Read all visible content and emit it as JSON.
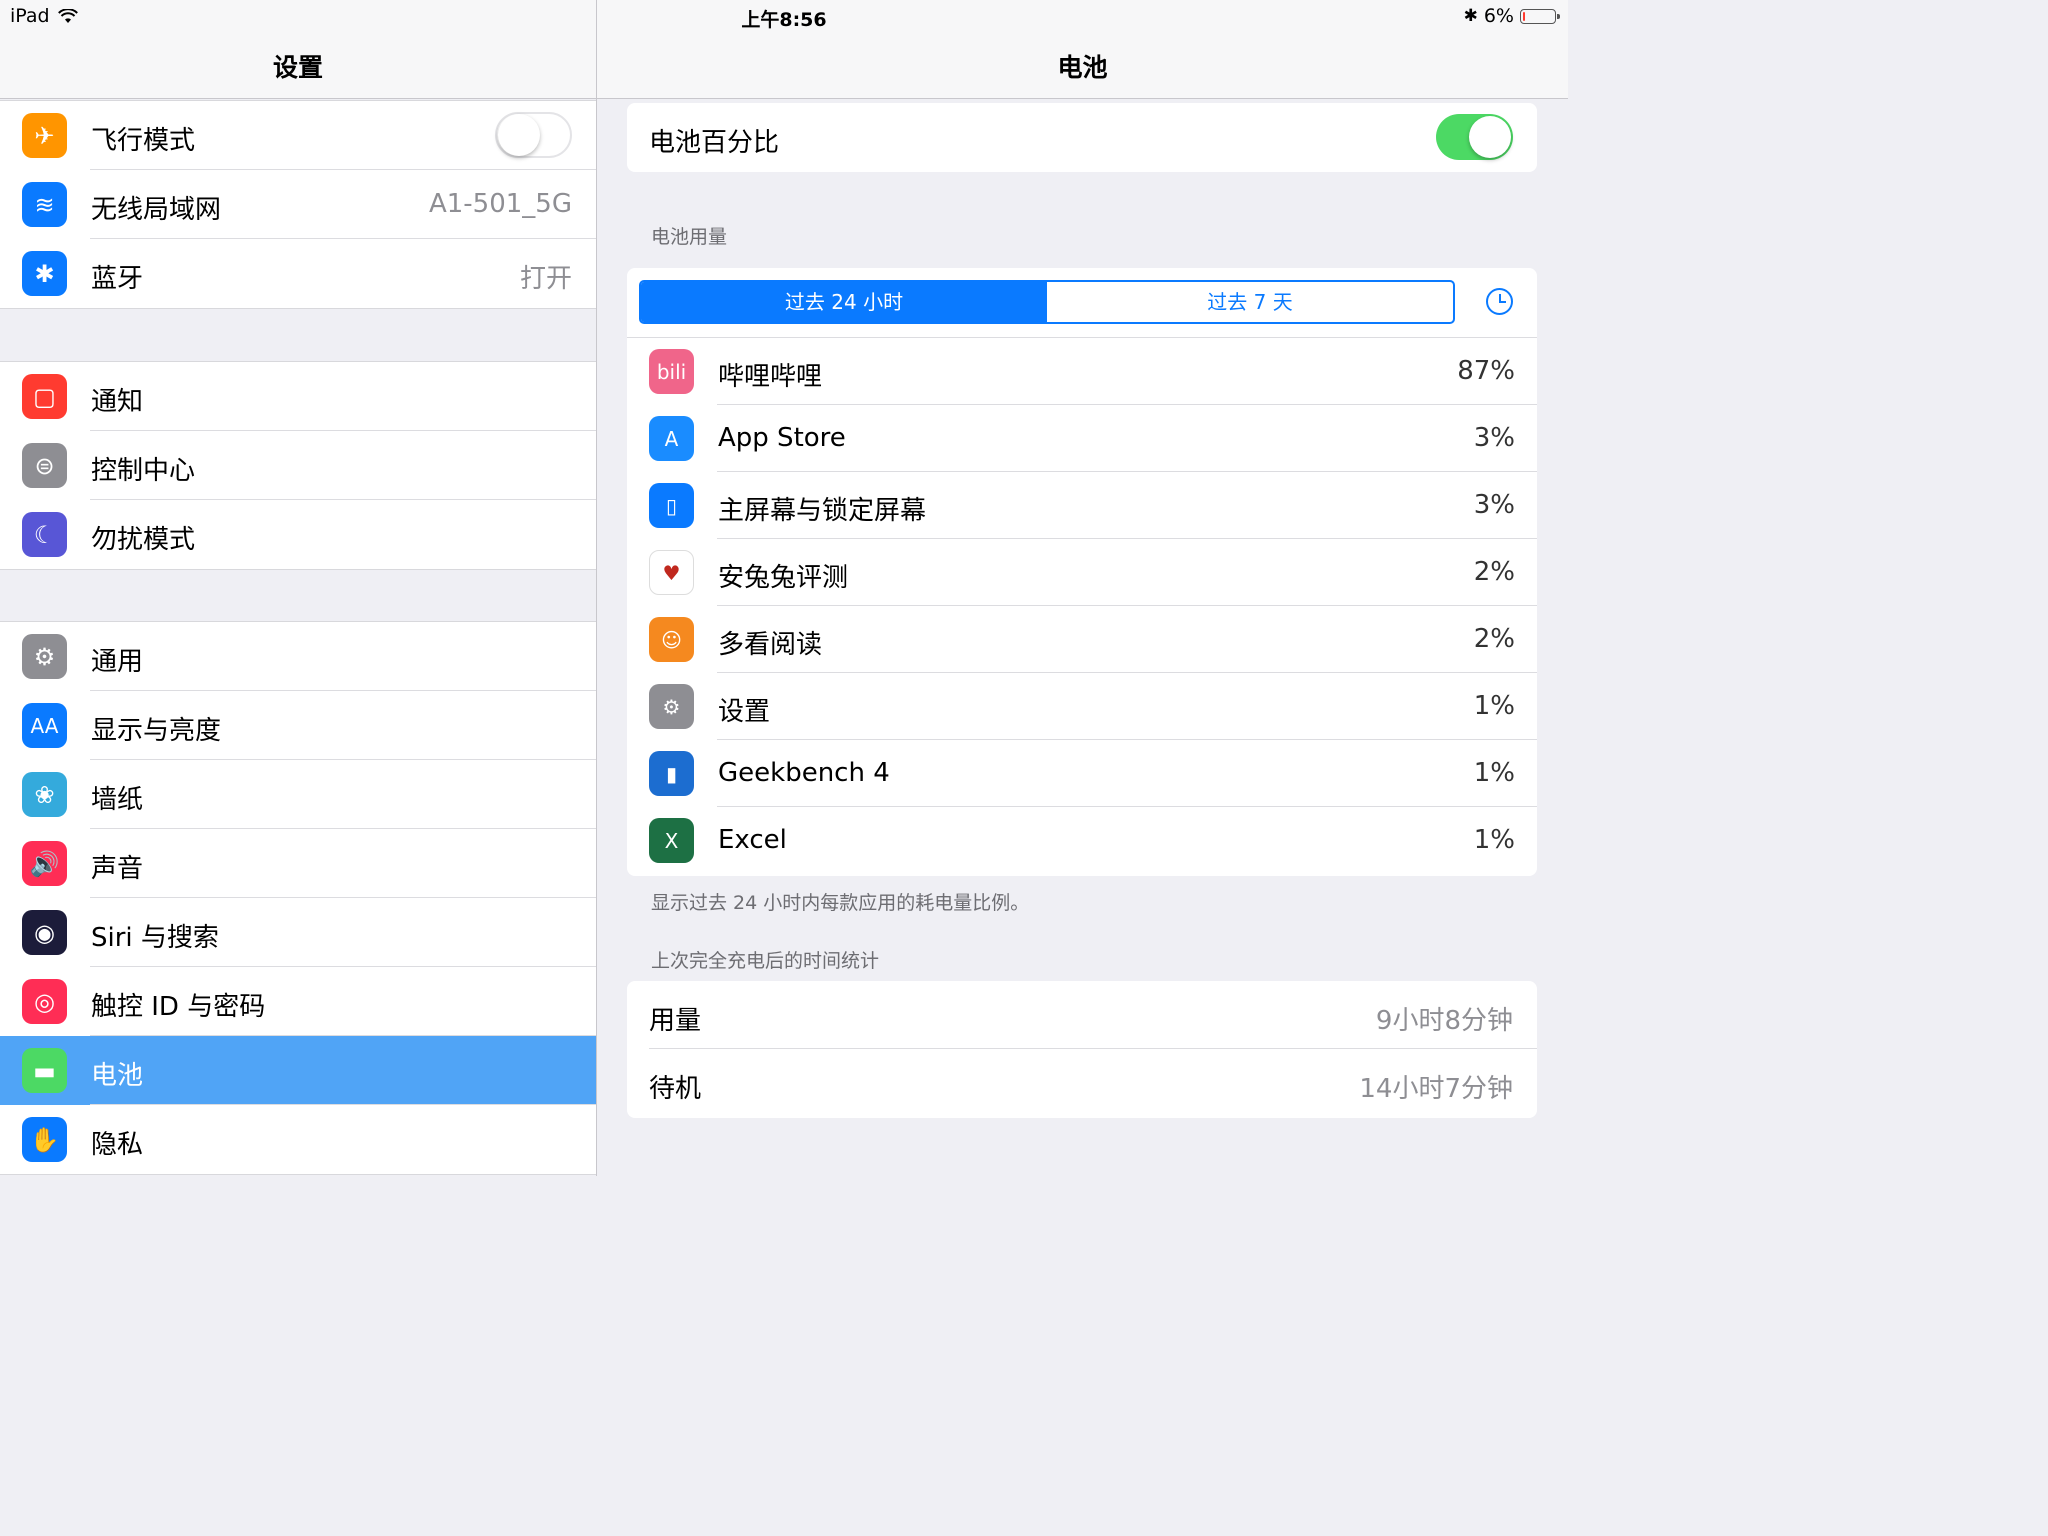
{
  "status": {
    "device": "iPad",
    "time": "上午8:56",
    "battery_percent": "6%",
    "battery_level": 0.06
  },
  "master": {
    "title": "设置",
    "group1": [
      {
        "label": "飞行模式",
        "toggle": false,
        "icon": "airplane-icon",
        "color": "#ff9500"
      },
      {
        "label": "无线局域网",
        "value": "A1-501_5G",
        "icon": "wifi-icon",
        "color": "#0a7aff"
      },
      {
        "label": "蓝牙",
        "value": "打开",
        "icon": "bluetooth-icon",
        "color": "#0a7aff"
      }
    ],
    "group2": [
      {
        "label": "通知",
        "icon": "notification-icon",
        "color": "#ff3b30"
      },
      {
        "label": "控制中心",
        "icon": "control-center-icon",
        "color": "#8e8e93"
      },
      {
        "label": "勿扰模式",
        "icon": "moon-icon",
        "color": "#5856d6"
      }
    ],
    "group3": [
      {
        "label": "通用",
        "icon": "gear-icon",
        "color": "#8e8e93"
      },
      {
        "label": "显示与亮度",
        "icon_text": "AA",
        "icon": "display-icon",
        "color": "#0a7aff"
      },
      {
        "label": "墙纸",
        "icon": "wallpaper-icon",
        "color": "#34aadc"
      },
      {
        "label": "声音",
        "icon": "sound-icon",
        "color": "#ff2d55"
      },
      {
        "label": "Siri 与搜索",
        "icon": "siri-icon",
        "color": "#1c1c3a"
      },
      {
        "label": "触控 ID 与密码",
        "icon": "fingerprint-icon",
        "color": "#ff2d55"
      },
      {
        "label": "电池",
        "icon": "battery-icon",
        "color": "#4cd964",
        "selected": true
      },
      {
        "label": "隐私",
        "icon": "privacy-hand-icon",
        "color": "#0a7aff"
      }
    ]
  },
  "detail": {
    "title": "电池",
    "battery_percentage": {
      "label": "电池百分比",
      "toggle": true
    },
    "usage_header": "电池用量",
    "segments": [
      "过去 24 小时",
      "过去 7 天"
    ],
    "apps": [
      {
        "name": "哔哩哔哩",
        "percent": "87%",
        "icon": "bilibili-icon",
        "color": "#f0658a",
        "icon_text": "bili"
      },
      {
        "name": "App Store",
        "percent": "3%",
        "icon": "app-store-icon",
        "color": "#1a8cff",
        "icon_text": "A"
      },
      {
        "name": "主屏幕与锁定屏幕",
        "percent": "3%",
        "icon": "home-lock-screen-icon",
        "color": "#0a7aff"
      },
      {
        "name": "安兔兔评测",
        "percent": "2%",
        "icon": "antutu-icon",
        "color": "#ffffff"
      },
      {
        "name": "多看阅读",
        "percent": "2%",
        "icon": "duokan-icon",
        "color": "#f5891f"
      },
      {
        "name": "设置",
        "percent": "1%",
        "icon": "settings-icon",
        "color": "#8e8e93"
      },
      {
        "name": "Geekbench 4",
        "percent": "1%",
        "icon": "geekbench-icon",
        "color": "#1c6dd0"
      },
      {
        "name": "Excel",
        "percent": "1%",
        "icon": "excel-icon",
        "color": "#1d7044",
        "icon_text": "X"
      }
    ],
    "usage_footer": "显示过去 24 小时内每款应用的耗电量比例。",
    "since_charge_header": "上次完全充电后的时间统计",
    "stats": [
      {
        "label": "用量",
        "value": "9小时8分钟"
      },
      {
        "label": "待机",
        "value": "14小时7分钟"
      }
    ]
  }
}
